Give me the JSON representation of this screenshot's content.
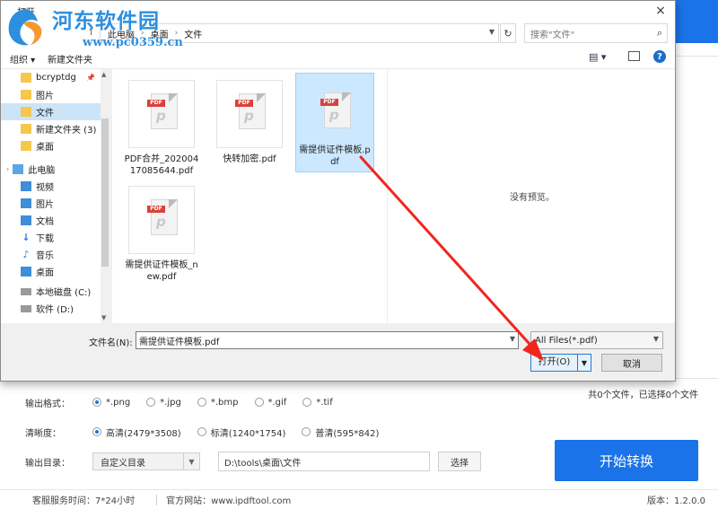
{
  "watermark": {
    "title": "河东软件园",
    "url": "www.pc0359.cn"
  },
  "dialog": {
    "title": "打开",
    "close": "×",
    "address": {
      "crumbs": [
        "此电脑",
        "桌面",
        "文件"
      ]
    },
    "search_placeholder": "搜索\"文件\"",
    "toolbar": {
      "organize": "组织 ▾",
      "new_folder": "新建文件夹",
      "help": "?"
    },
    "nav_items": [
      {
        "label": "bcryptdg",
        "icon": "folder-icon",
        "pinned": true
      },
      {
        "label": "图片",
        "icon": "folder-icon"
      },
      {
        "label": "文件",
        "icon": "folder-icon",
        "selected": true
      },
      {
        "label": "新建文件夹 (3)",
        "icon": "folder-icon"
      },
      {
        "label": "桌面",
        "icon": "folder-icon"
      },
      {
        "label": "此电脑",
        "icon": "computer-icon"
      },
      {
        "label": "视频",
        "icon": "video-icon"
      },
      {
        "label": "图片",
        "icon": "picture-icon"
      },
      {
        "label": "文档",
        "icon": "document-icon"
      },
      {
        "label": "下载",
        "icon": "download-icon"
      },
      {
        "label": "音乐",
        "icon": "music-icon"
      },
      {
        "label": "桌面",
        "icon": "desktop-icon"
      },
      {
        "label": "本地磁盘 (C:)",
        "icon": "drive-icon"
      },
      {
        "label": "软件 (D:)",
        "icon": "drive-icon"
      }
    ],
    "files": [
      {
        "name": "PDF合并_20200417085644.pdf",
        "selected": false
      },
      {
        "name": "快转加密.pdf",
        "selected": false
      },
      {
        "name": "需提供证件模板.pdf",
        "selected": true
      },
      {
        "name": "需提供证件模板_new.pdf",
        "selected": false
      }
    ],
    "pdf_tag": "PDF",
    "preview_text": "没有预览。",
    "filename_label": "文件名(N):",
    "filename_value": "需提供证件模板.pdf",
    "filetype_value": "All Files(*.pdf)",
    "open_label": "打开(O)",
    "cancel_label": "取消"
  },
  "app": {
    "count_text": "共0个文件，已选择0个文件",
    "format": {
      "label": "输出格式：",
      "options": [
        "*.png",
        "*.jpg",
        "*.bmp",
        "*.gif",
        "*.tif"
      ],
      "selected": 0
    },
    "quality": {
      "label": "清晰度：",
      "options": [
        "高清(2479*3508)",
        "标清(1240*1754)",
        "普清(595*842)"
      ],
      "selected": 0
    },
    "output": {
      "label": "输出目录：",
      "mode": "自定义目录",
      "path": "D:\\tools\\桌面\\文件",
      "browse": "选择"
    },
    "convert_button": "开始转换",
    "footer": {
      "service": "客服服务时间：7*24小时",
      "website": "官方网站：www.ipdftool.com",
      "version": "版本：1.2.0.0"
    }
  },
  "colors": {
    "accent": "#1a73e8",
    "arrow": "#f0261d",
    "selection": "#cce8ff"
  }
}
